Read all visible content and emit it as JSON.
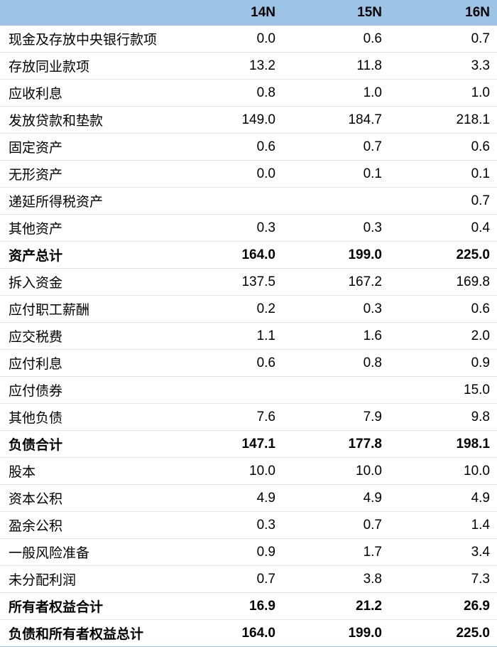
{
  "header": {
    "label": "",
    "years": [
      "14N",
      "15N",
      "16N"
    ]
  },
  "rows": [
    {
      "label": "现金及存放中央银行款项",
      "values": [
        "0.0",
        "0.6",
        "0.7"
      ],
      "bold": false
    },
    {
      "label": "存放同业款项",
      "values": [
        "13.2",
        "11.8",
        "3.3"
      ],
      "bold": false
    },
    {
      "label": "应收利息",
      "values": [
        "0.8",
        "1.0",
        "1.0"
      ],
      "bold": false
    },
    {
      "label": "发放贷款和垫款",
      "values": [
        "149.0",
        "184.7",
        "218.1"
      ],
      "bold": false
    },
    {
      "label": "固定资产",
      "values": [
        "0.6",
        "0.7",
        "0.6"
      ],
      "bold": false
    },
    {
      "label": "无形资产",
      "values": [
        "0.0",
        "0.1",
        "0.1"
      ],
      "bold": false
    },
    {
      "label": "递延所得税资产",
      "values": [
        "",
        "",
        "0.7"
      ],
      "bold": false
    },
    {
      "label": "其他资产",
      "values": [
        "0.3",
        "0.3",
        "0.4"
      ],
      "bold": false
    },
    {
      "label": "资产总计",
      "values": [
        "164.0",
        "199.0",
        "225.0"
      ],
      "bold": true
    },
    {
      "label": "拆入资金",
      "values": [
        "137.5",
        "167.2",
        "169.8"
      ],
      "bold": false
    },
    {
      "label": "应付职工薪酬",
      "values": [
        "0.2",
        "0.3",
        "0.6"
      ],
      "bold": false
    },
    {
      "label": "应交税费",
      "values": [
        "1.1",
        "1.6",
        "2.0"
      ],
      "bold": false
    },
    {
      "label": "应付利息",
      "values": [
        "0.6",
        "0.8",
        "0.9"
      ],
      "bold": false
    },
    {
      "label": "应付债券",
      "values": [
        "",
        "",
        "15.0"
      ],
      "bold": false
    },
    {
      "label": "其他负债",
      "values": [
        "7.6",
        "7.9",
        "9.8"
      ],
      "bold": false
    },
    {
      "label": "负债合计",
      "values": [
        "147.1",
        "177.8",
        "198.1"
      ],
      "bold": true
    },
    {
      "label": "股本",
      "values": [
        "10.0",
        "10.0",
        "10.0"
      ],
      "bold": false
    },
    {
      "label": "资本公积",
      "values": [
        "4.9",
        "4.9",
        "4.9"
      ],
      "bold": false
    },
    {
      "label": "盈余公积",
      "values": [
        "0.3",
        "0.7",
        "1.4"
      ],
      "bold": false
    },
    {
      "label": "一般风险准备",
      "values": [
        "0.9",
        "1.7",
        "3.4"
      ],
      "bold": false
    },
    {
      "label": "未分配利润",
      "values": [
        "0.7",
        "3.8",
        "7.3"
      ],
      "bold": false
    },
    {
      "label": "所有者权益合计",
      "values": [
        "16.9",
        "21.2",
        "26.9"
      ],
      "bold": true
    },
    {
      "label": "负债和所有者权益总计",
      "values": [
        "164.0",
        "199.0",
        "225.0"
      ],
      "bold": true
    }
  ]
}
